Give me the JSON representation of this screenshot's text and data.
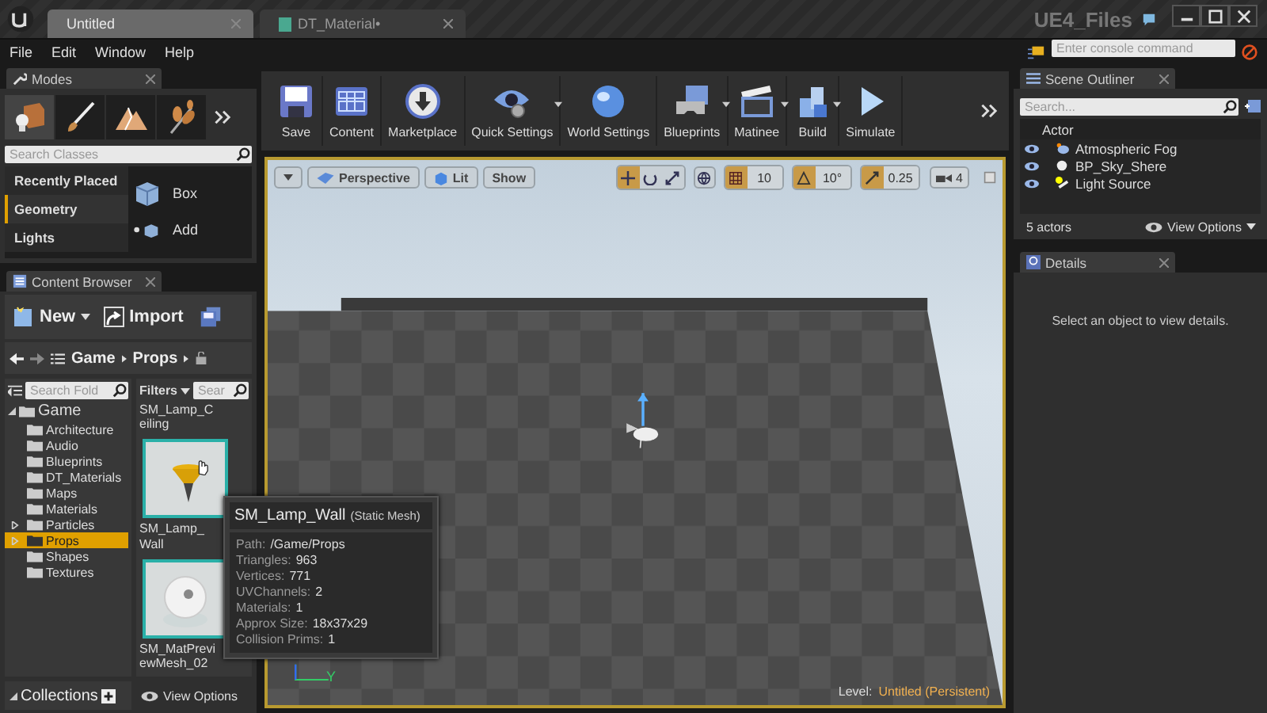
{
  "title_bar": {
    "tabs": [
      {
        "label": "Untitled",
        "selected": true
      },
      {
        "label": "DT_Material•",
        "selected": false
      }
    ],
    "project": "UE4_Files"
  },
  "menu": [
    "File",
    "Edit",
    "Window",
    "Help"
  ],
  "console": {
    "placeholder": "Enter console command"
  },
  "modes": {
    "title": "Modes",
    "search": {
      "placeholder": "Search Classes"
    },
    "categories": [
      {
        "label": "Recently Placed",
        "selected": false
      },
      {
        "label": "Geometry",
        "selected": true
      },
      {
        "label": "Lights",
        "selected": false
      }
    ],
    "item": "Box",
    "add_label": "Add"
  },
  "toolbar": [
    {
      "label": "Save",
      "dropdown": false
    },
    {
      "label": "Content",
      "dropdown": false
    },
    {
      "label": "Marketplace",
      "dropdown": false
    },
    {
      "label": "Quick Settings",
      "dropdown": true
    },
    {
      "label": "World Settings",
      "dropdown": false
    },
    {
      "label": "Blueprints",
      "dropdown": true
    },
    {
      "label": "Matinee",
      "dropdown": true
    },
    {
      "label": "Build",
      "dropdown": true
    },
    {
      "label": "Simulate",
      "dropdown": false
    }
  ],
  "content_browser": {
    "title": "Content Browser",
    "new_label": "New",
    "import_label": "Import",
    "path": [
      "Game",
      "Props"
    ],
    "folder_search": {
      "placeholder": "Search Fold"
    },
    "filters_label": "Filters",
    "asset_search": {
      "placeholder": "Sear"
    },
    "folders": [
      {
        "label": "Game",
        "expandable": true,
        "expanded": true,
        "selected": false,
        "children": [
          {
            "label": "Architecture",
            "expandable": false,
            "selected": false
          },
          {
            "label": "Audio",
            "expandable": false,
            "selected": false
          },
          {
            "label": "Blueprints",
            "expandable": false,
            "selected": false
          },
          {
            "label": "DT_Materials",
            "expandable": false,
            "selected": false
          },
          {
            "label": "Maps",
            "expandable": false,
            "selected": false
          },
          {
            "label": "Materials",
            "expandable": false,
            "selected": false
          },
          {
            "label": "Particles",
            "expandable": true,
            "expanded": false,
            "selected": false
          },
          {
            "label": "Props",
            "expandable": true,
            "expanded": false,
            "selected": true
          },
          {
            "label": "Shapes",
            "expandable": false,
            "selected": false
          },
          {
            "label": "Textures",
            "expandable": false,
            "selected": false
          }
        ]
      }
    ],
    "assets": [
      {
        "name": "SM_Lamp_Ceiling",
        "kind": "label"
      },
      {
        "name": "SM_Lamp_Wall",
        "kind": "lamp"
      },
      {
        "name": "SM_MatPreviewMesh_02",
        "kind": "sphere"
      }
    ],
    "collections_label": "Collections",
    "view_options": "View Options"
  },
  "viewport": {
    "view_label": "Perspective",
    "lit_label": "Lit",
    "show_label": "Show",
    "tools": [
      {
        "selected": true
      },
      {
        "selected": false
      },
      {
        "selected": false
      }
    ],
    "snaps": [
      {
        "on": true,
        "value": "10"
      },
      {
        "on": true,
        "value": "10°"
      },
      {
        "on": true,
        "value": "0.25"
      }
    ],
    "camera_speed": "4",
    "axis_label": "Y",
    "level_label": "Level:",
    "level_name": "Untitled (Persistent)"
  },
  "tooltip": {
    "title": "SM_Lamp_Wall",
    "type": "(Static Mesh)",
    "rows": [
      {
        "label": "Path:",
        "value": "/Game/Props"
      },
      {
        "label": "Triangles:",
        "value": "963"
      },
      {
        "label": "Vertices:",
        "value": "771"
      },
      {
        "label": "UVChannels:",
        "value": "2"
      },
      {
        "label": "Materials:",
        "value": "1"
      },
      {
        "label": "Approx Size:",
        "value": "18x37x29"
      },
      {
        "label": "Collision Prims:",
        "value": "1"
      }
    ]
  },
  "scene_outliner": {
    "title": "Scene Outliner",
    "search": {
      "placeholder": "Search..."
    },
    "column": "Actor",
    "rows": [
      {
        "label": "Atmospheric Fog"
      },
      {
        "label": "BP_Sky_Shere"
      },
      {
        "label": "Light Source"
      }
    ],
    "count": "5 actors",
    "view_options": "View Options"
  },
  "details": {
    "title": "Details",
    "message": "Select an object to view details."
  }
}
